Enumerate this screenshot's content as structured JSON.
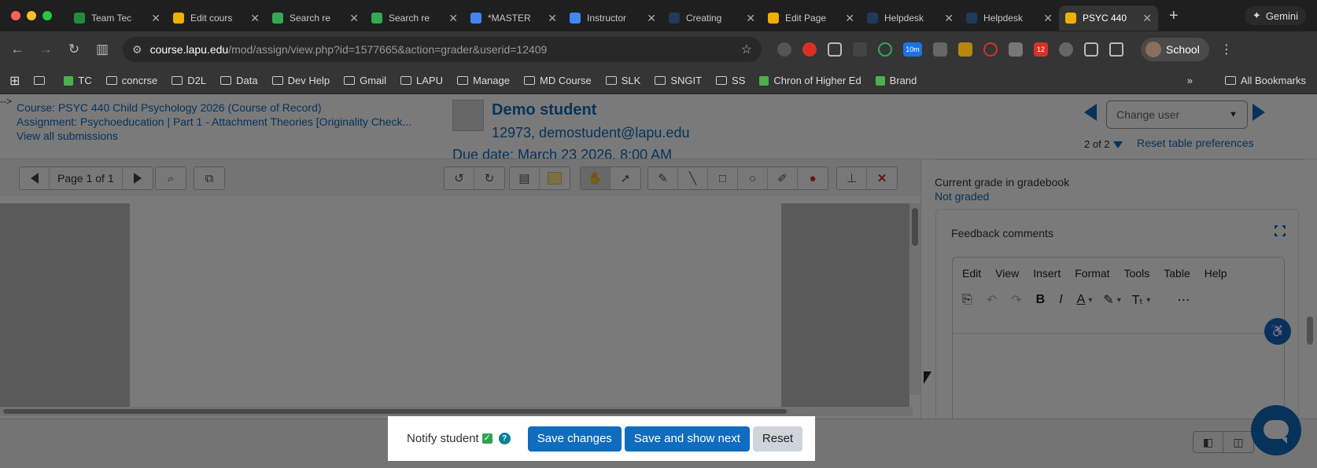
{
  "browser": {
    "tabs": [
      {
        "title": "Team Tec",
        "favicon_color": "#1e8e3e",
        "active": false
      },
      {
        "title": "Edit cours",
        "favicon_color": "#f1b000",
        "active": false
      },
      {
        "title": "Search re",
        "favicon_color": "#34a853",
        "active": false
      },
      {
        "title": "Search re",
        "favicon_color": "#34a853",
        "active": false
      },
      {
        "title": "*MASTER",
        "favicon_color": "#4285f4",
        "active": false
      },
      {
        "title": "Instructor",
        "favicon_color": "#4285f4",
        "active": false
      },
      {
        "title": "Creating",
        "favicon_color": "#203a5c",
        "active": false
      },
      {
        "title": "Edit Page",
        "favicon_color": "#f1b000",
        "active": false
      },
      {
        "title": "Helpdesk",
        "favicon_color": "#203a5c",
        "active": false
      },
      {
        "title": "Helpdesk",
        "favicon_color": "#203a5c",
        "active": false
      },
      {
        "title": "PSYC 440",
        "favicon_color": "#f1b000",
        "active": true
      }
    ],
    "gemini_label": "Gemini",
    "url_domain": "course.lapu.edu",
    "url_path": "/mod/assign/view.php?id=1577665&action=grader&userid=12409",
    "profile_label": "School",
    "extension_badge_calendar": "10m",
    "extension_badge_count": "12",
    "bookmarks": [
      {
        "label": "",
        "kind": "folder"
      },
      {
        "label": "TC",
        "kind": "item"
      },
      {
        "label": "concrse",
        "kind": "folder"
      },
      {
        "label": "D2L",
        "kind": "folder"
      },
      {
        "label": "Data",
        "kind": "folder"
      },
      {
        "label": "Dev Help",
        "kind": "folder"
      },
      {
        "label": "Gmail",
        "kind": "folder"
      },
      {
        "label": "LAPU",
        "kind": "folder"
      },
      {
        "label": "Manage",
        "kind": "folder"
      },
      {
        "label": "MD Course",
        "kind": "folder"
      },
      {
        "label": "SLK",
        "kind": "folder"
      },
      {
        "label": "SNGIT",
        "kind": "folder"
      },
      {
        "label": "SS",
        "kind": "folder"
      },
      {
        "label": "Chron of Higher Ed",
        "kind": "item"
      },
      {
        "label": "Brand",
        "kind": "item"
      }
    ],
    "all_bookmarks_label": "All Bookmarks"
  },
  "header": {
    "stray_text": "-->",
    "course_link": "Course: PSYC 440 Child Psychology 2026 (Course of Record)",
    "assignment_link": "Assignment: Psychoeducation | Part 1 - Attachment Theories [Originality Check...",
    "view_all_link": "View all submissions",
    "student_name": "Demo student",
    "student_id_email": "12973, demostudent@lapu.edu",
    "due_date": "Due date: March 23 2026, 8:00 AM",
    "change_user_placeholder": "Change user",
    "user_count": "2 of 2",
    "reset_table_prefs": "Reset table preferences"
  },
  "pdf_toolbar": {
    "page_label": "Page 1 of 1"
  },
  "grading_panel": {
    "current_grade_label": "Current grade in gradebook",
    "current_grade_value": "Not graded",
    "feedback_title": "Feedback comments",
    "editor_menus": [
      "Edit",
      "View",
      "Insert",
      "Format",
      "Tools",
      "Table",
      "Help"
    ]
  },
  "actions": {
    "notify_label": "Notify student",
    "notify_checked": true,
    "save_changes": "Save changes",
    "save_and_next": "Save and show next",
    "reset": "Reset"
  },
  "colors": {
    "link_blue": "#0f6cbf",
    "overlay": "rgba(0,0,0,0.52)",
    "secondary_button": "#ced4da",
    "help_icon": "#008196"
  }
}
